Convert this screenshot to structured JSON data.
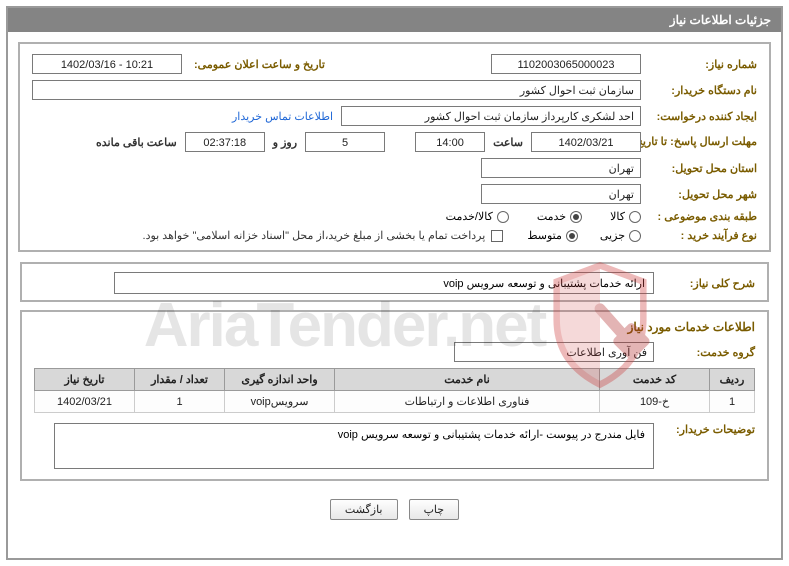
{
  "header": {
    "title": "جزئیات اطلاعات نیاز"
  },
  "fields": {
    "need_no_label": "شماره نیاز:",
    "need_no_value": "1102003065000023",
    "announce_label": "تاریخ و ساعت اعلان عمومی:",
    "announce_value": "1402/03/16 - 10:21",
    "buyer_org_label": "نام دستگاه خریدار:",
    "buyer_org_value": "سازمان ثبت احوال کشور",
    "requester_label": "ایجاد کننده درخواست:",
    "requester_value": "احد لشکری کارپرداز سازمان ثبت احوال کشور",
    "buyer_contact_link": "اطلاعات تماس خریدار",
    "deadline_label": "مهلت ارسال پاسخ: تا تاریخ:",
    "deadline_date": "1402/03/21",
    "time_label": "ساعت",
    "deadline_time": "14:00",
    "days_count": "5",
    "days_and_label": "روز و",
    "countdown_time": "02:37:18",
    "remaining_label": "ساعت باقی مانده",
    "delivery_province_label": "استان محل تحویل:",
    "delivery_province_value": "تهران",
    "delivery_city_label": "شهر محل تحویل:",
    "delivery_city_value": "تهران",
    "category_label": "طبقه بندی موضوعی :",
    "opt_goods": "کالا",
    "opt_service": "خدمت",
    "opt_goods_service": "کالا/خدمت",
    "process_type_label": "نوع فرآیند خرید :",
    "opt_minor": "جزیی",
    "opt_medium": "متوسط",
    "treasury_note": "پرداخت تمام یا بخشی از مبلغ خرید،از محل \"اسناد خزانه اسلامی\" خواهد بود."
  },
  "desc": {
    "label": "شرح کلی نیاز:",
    "value": "ارائه خدمات پشتیبانی و توسعه سرویس voip"
  },
  "services": {
    "section_title": "اطلاعات خدمات مورد نیاز",
    "group_label": "گروه خدمت:",
    "group_value": "فن آوری اطلاعات",
    "columns": {
      "row": "ردیف",
      "code": "کد خدمت",
      "name": "نام خدمت",
      "unit": "واحد اندازه گیری",
      "qty": "تعداد / مقدار",
      "date": "تاریخ نیاز"
    },
    "rows": [
      {
        "row": "1",
        "code": "خ-109",
        "name": "فناوری اطلاعات و ارتباطات",
        "unit": "سرویسvoip",
        "qty": "1",
        "date": "1402/03/21"
      }
    ]
  },
  "buyer_notes": {
    "label": "توضیحات خریدار:",
    "value": "فایل مندرج در پیوست   -ارائه خدمات پشتیبانی و توسعه سرویس voip"
  },
  "buttons": {
    "print": "چاپ",
    "back": "بازگشت"
  },
  "watermark": {
    "text": "AriaTender.net"
  }
}
